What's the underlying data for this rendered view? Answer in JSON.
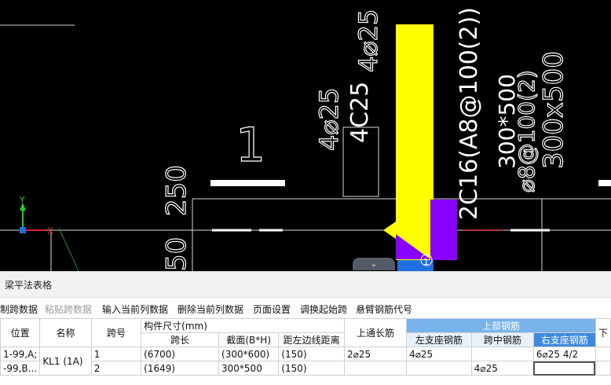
{
  "cad": {
    "texts": {
      "t_4c25": "4⌀25",
      "t_4c25b": "4⌀25",
      "t_4C25": "4C25",
      "t_1": "1",
      "t_250": "250",
      "t_50": "50",
      "t_2c16": "2C16(A8@100(2))",
      "t_300x500a": "300*500",
      "t_300x500b": "300x500",
      "t_a8": "⌀8@100(2)",
      "t_marker": "1"
    },
    "colors": {
      "yellow": "#ffff00",
      "violet": "#8a00ff",
      "blue": "#1e6fe0"
    },
    "axis": {
      "y": "Y",
      "x": "X"
    },
    "collapse_icon": "chevron-down-icon"
  },
  "panel": {
    "title": "梁平法表格",
    "toolbar": {
      "copy": "制跨数据",
      "paste": "粘贴跨数据",
      "input_col": "输入当前列数据",
      "delete_col": "删除当前列数据",
      "page_setup": "页面设置",
      "swap_start": "调换起始跨",
      "cantilever": "悬臂钢筋代号"
    },
    "table": {
      "headers": {
        "position": "位置",
        "name": "名称",
        "span_no": "跨号",
        "dims": "构件尺寸(mm)",
        "span_len": "跨长",
        "section": "截面(B*H)",
        "offset": "距左边线距离",
        "top_through": "上通长筋",
        "top_rebar": "上部钢筋",
        "left_support": "左支座钢筋",
        "mid_span": "跨中钢筋",
        "right_support": "右支座钢筋",
        "extra": "下"
      },
      "rows": [
        {
          "position": "1-99,A;",
          "name": "KL1 (1A)",
          "span_no": "1",
          "span_len": "(6700)",
          "section": "(300*600)",
          "offset": "(150)",
          "top_through": "2⌀25",
          "left_support": "4⌀25",
          "mid_span": "",
          "right_support": "6⌀25 4/2"
        },
        {
          "position": "-99,B...",
          "name": "",
          "span_no": "2",
          "span_len": "(1649)",
          "section": "300*500",
          "offset": "(150)",
          "top_through": "",
          "left_support": "",
          "mid_span": "4⌀25",
          "right_support": ""
        }
      ]
    }
  }
}
